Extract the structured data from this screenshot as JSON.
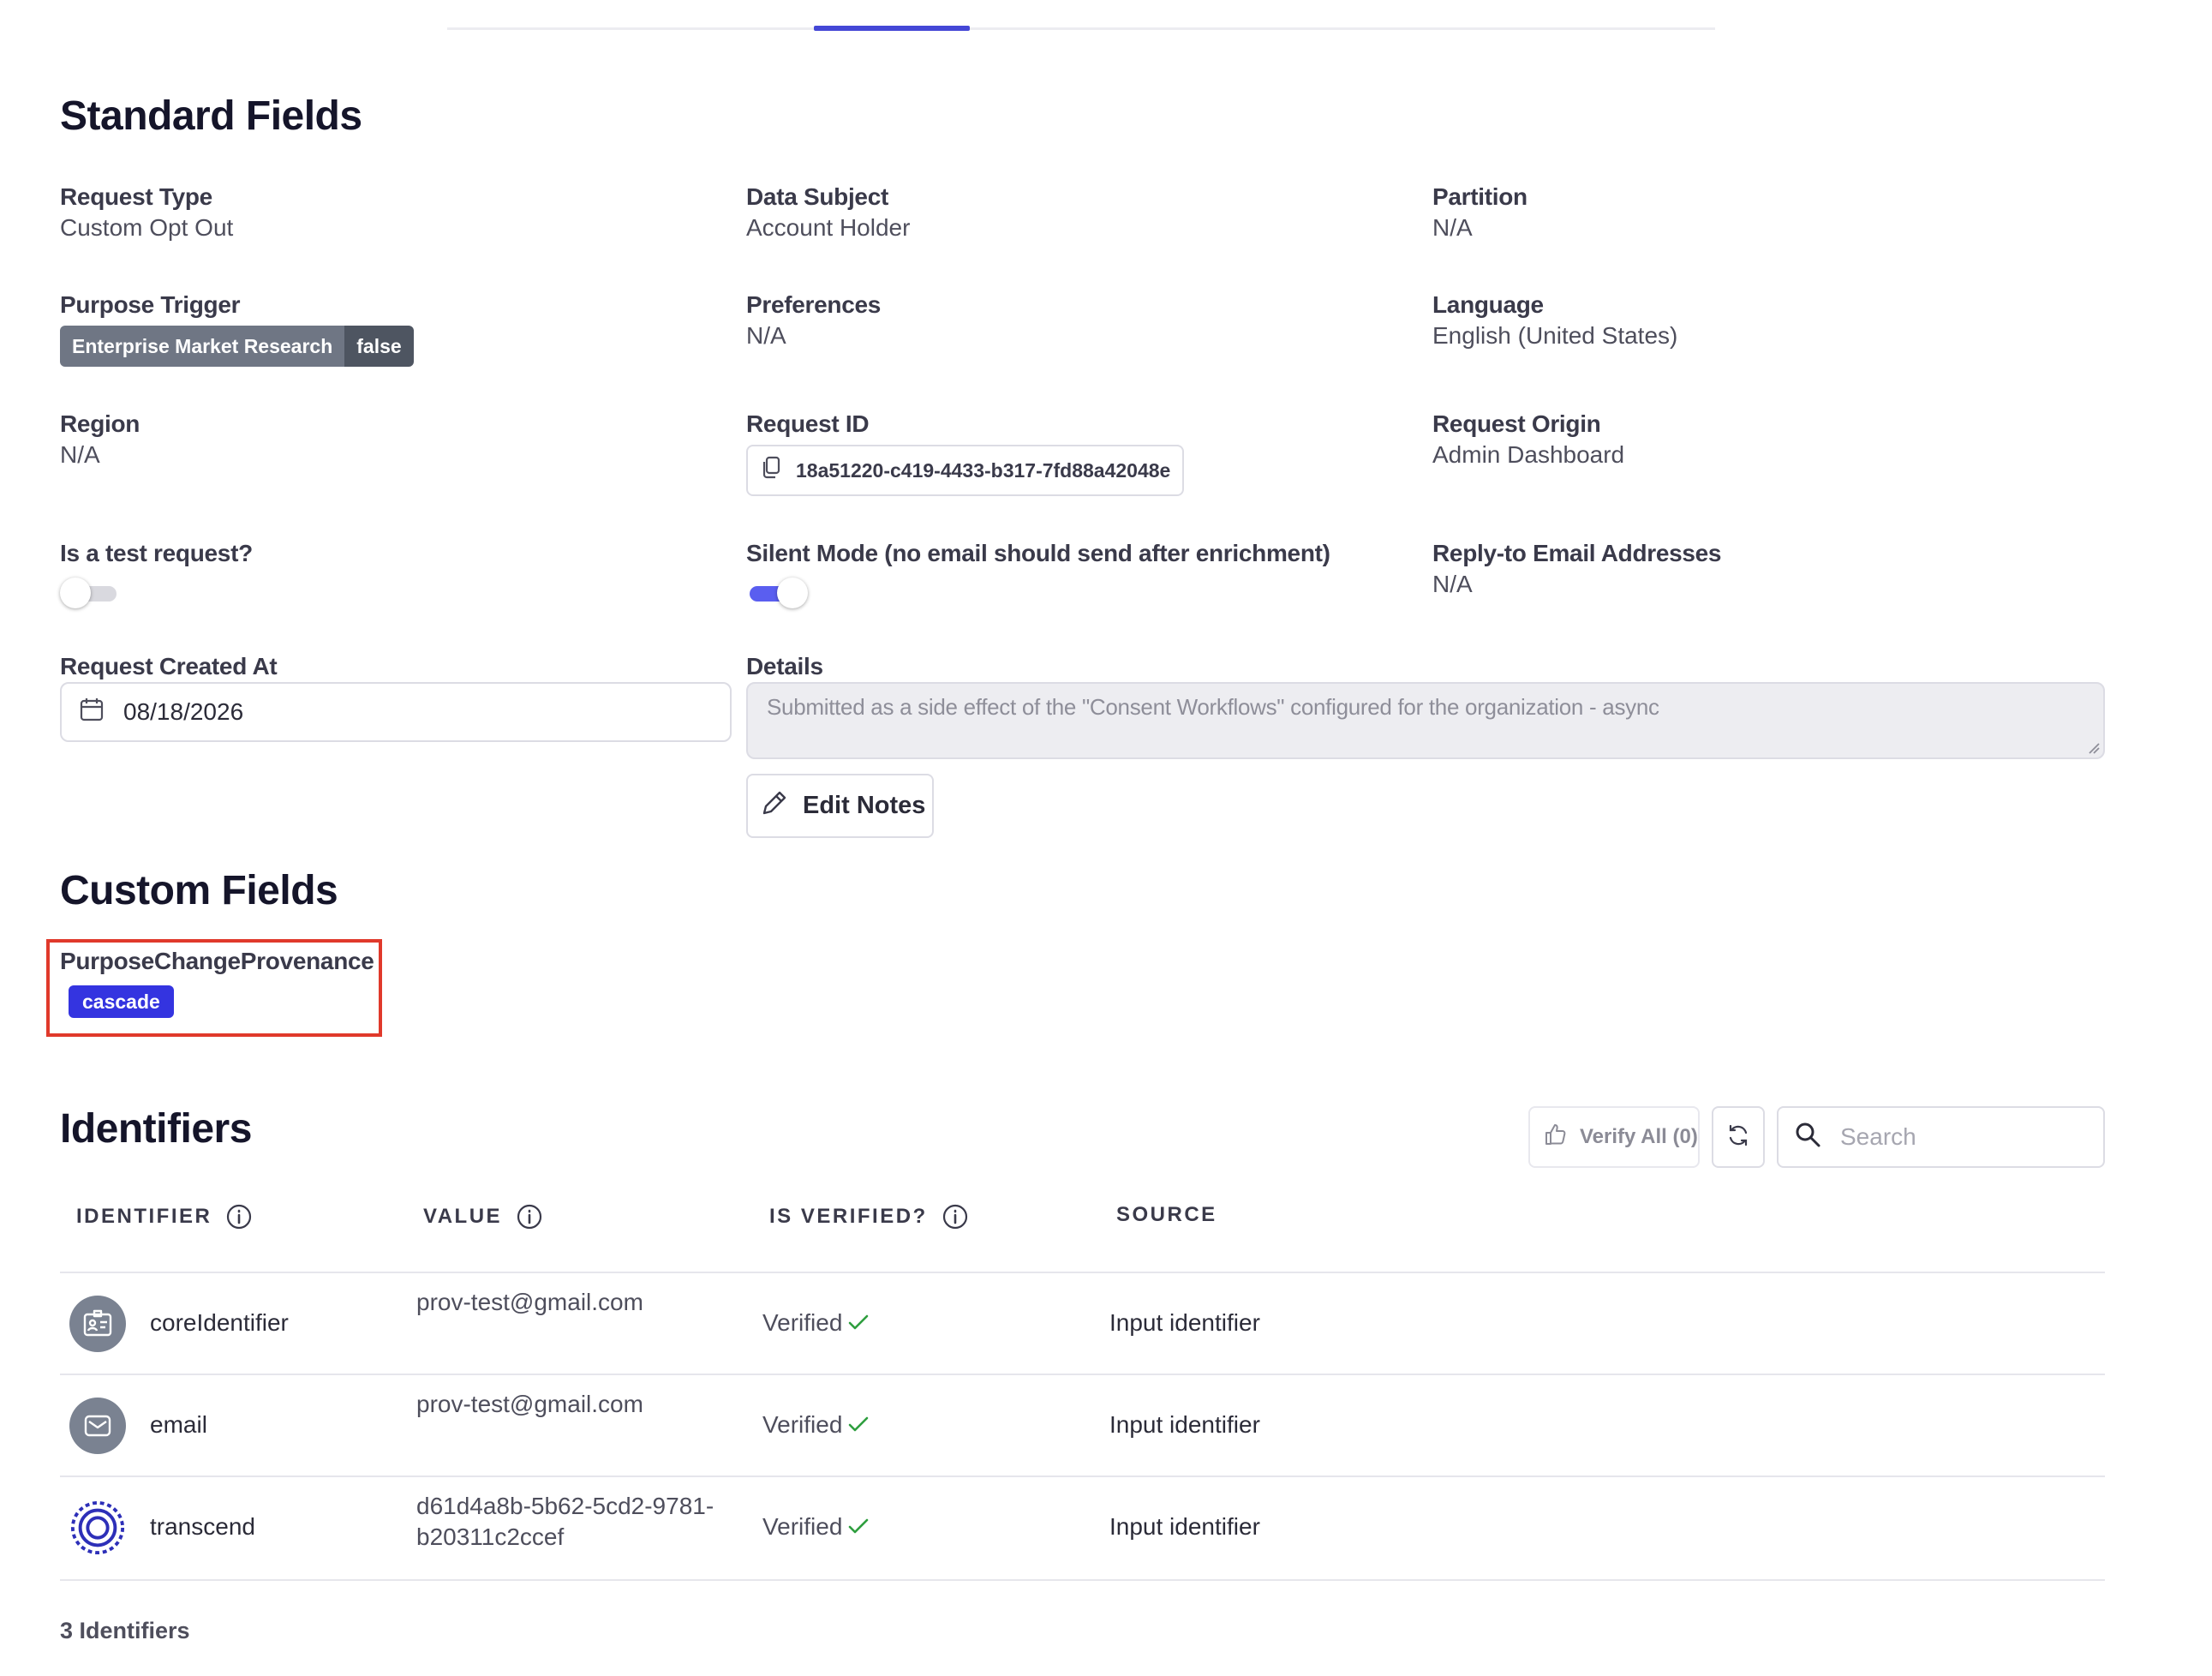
{
  "sections": {
    "standard_title": "Standard Fields",
    "custom_title": "Custom Fields",
    "identifiers_title": "Identifiers"
  },
  "standard": {
    "request_type": {
      "label": "Request Type",
      "value": "Custom Opt Out"
    },
    "data_subject": {
      "label": "Data Subject",
      "value": "Account Holder"
    },
    "partition": {
      "label": "Partition",
      "value": "N/A"
    },
    "purpose_trigger": {
      "label": "Purpose Trigger",
      "key": "Enterprise Market Research",
      "value": "false"
    },
    "preferences": {
      "label": "Preferences",
      "value": "N/A"
    },
    "language": {
      "label": "Language",
      "value": "English (United States)"
    },
    "region": {
      "label": "Region",
      "value": "N/A"
    },
    "request_id": {
      "label": "Request ID",
      "value": "18a51220-c419-4433-b317-7fd88a42048e"
    },
    "request_origin": {
      "label": "Request Origin",
      "value": "Admin Dashboard"
    },
    "is_test": {
      "label": "Is a test request?",
      "enabled": false
    },
    "silent_mode": {
      "label": "Silent Mode (no email should send after enrichment)",
      "enabled": true
    },
    "reply_to": {
      "label": "Reply-to Email Addresses",
      "value": "N/A"
    },
    "created_at": {
      "label": "Request Created At",
      "value": "08/18/2026"
    },
    "details": {
      "label": "Details",
      "value": "Submitted as a side effect of the \"Consent Workflows\" configured for the organization - async"
    },
    "edit_notes_label": "Edit Notes"
  },
  "custom": {
    "field_label": "PurposeChangeProvenance",
    "field_value": "cascade"
  },
  "identifiers": {
    "verify_all_label": "Verify All (0)",
    "search_placeholder": "Search",
    "columns": [
      "IDENTIFIER",
      "VALUE",
      "IS VERIFIED?",
      "SOURCE"
    ],
    "rows": [
      {
        "name": "coreIdentifier",
        "value": "prov-test@gmail.com",
        "verified": "Verified",
        "source": "Input identifier",
        "icon": "id-card-icon"
      },
      {
        "name": "email",
        "value": "prov-test@gmail.com",
        "verified": "Verified",
        "source": "Input identifier",
        "icon": "envelope-icon"
      },
      {
        "name": "transcend",
        "value": "d61d4a8b-5b62-5cd2-9781-b20311c2ccef",
        "verified": "Verified",
        "source": "Input identifier",
        "icon": "transcend-logo-icon"
      }
    ],
    "count_label": "3 Identifiers"
  },
  "colors": {
    "accent": "#4447d6",
    "badge": "#3434e0",
    "verified_check": "#2e9e3e",
    "highlight_border": "#e0392b"
  }
}
